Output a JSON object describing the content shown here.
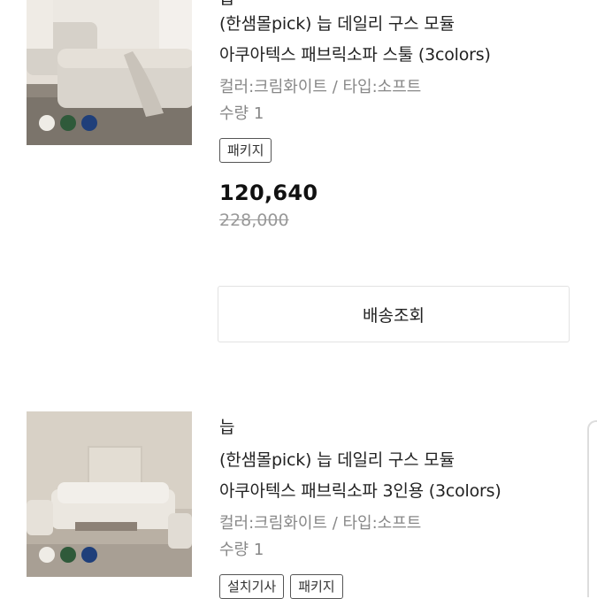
{
  "items": [
    {
      "brand": "늡",
      "title_line1": "(한샘몰pick) 늡 데일리 구스 모듈",
      "title_line2": "아쿠아텍스 패브릭소파 스툴 (3colors)",
      "option": "컬러:크림화이트 / 타입:소프트",
      "quantity": "수량 1",
      "tags": [
        "패키지"
      ],
      "price": "120,640",
      "original_price": "228,000",
      "shipping_button": "배송조회",
      "swatch_colors": [
        "#efece6",
        "#2f5a3a",
        "#1f3f7a"
      ]
    },
    {
      "brand": "늡",
      "title_line1": "(한샘몰pick) 늡 데일리 구스 모듈",
      "title_line2": "아쿠아텍스 패브릭소파 3인용 (3colors)",
      "option": "컬러:크림화이트 / 타입:소프트",
      "quantity": "수량 1",
      "tags": [
        "설치기사",
        "패키지"
      ],
      "swatch_colors": [
        "#efece6",
        "#2f5a3a",
        "#1f3f7a"
      ]
    }
  ]
}
